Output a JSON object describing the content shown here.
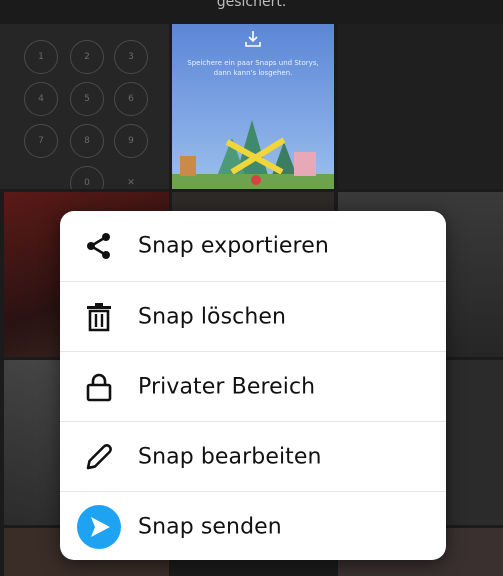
{
  "background": {
    "top_text": "gesichert.",
    "keypad": [
      "1",
      "2",
      "3",
      "4",
      "5",
      "6",
      "7",
      "8",
      "9",
      "0",
      "✕"
    ],
    "preview_hint": "Speichere ein paar Snaps und Storys, dann kann's losgehen."
  },
  "menu": {
    "items": [
      {
        "label": "Snap exportieren",
        "icon": "share-icon"
      },
      {
        "label": "Snap löschen",
        "icon": "trash-icon"
      },
      {
        "label": "Privater Bereich",
        "icon": "lock-icon"
      },
      {
        "label": "Snap bearbeiten",
        "icon": "pencil-icon"
      },
      {
        "label": "Snap senden",
        "icon": "send-icon"
      }
    ]
  },
  "colors": {
    "accent": "#1ea2f2",
    "menu_bg": "#ffffff",
    "text": "#111111"
  }
}
